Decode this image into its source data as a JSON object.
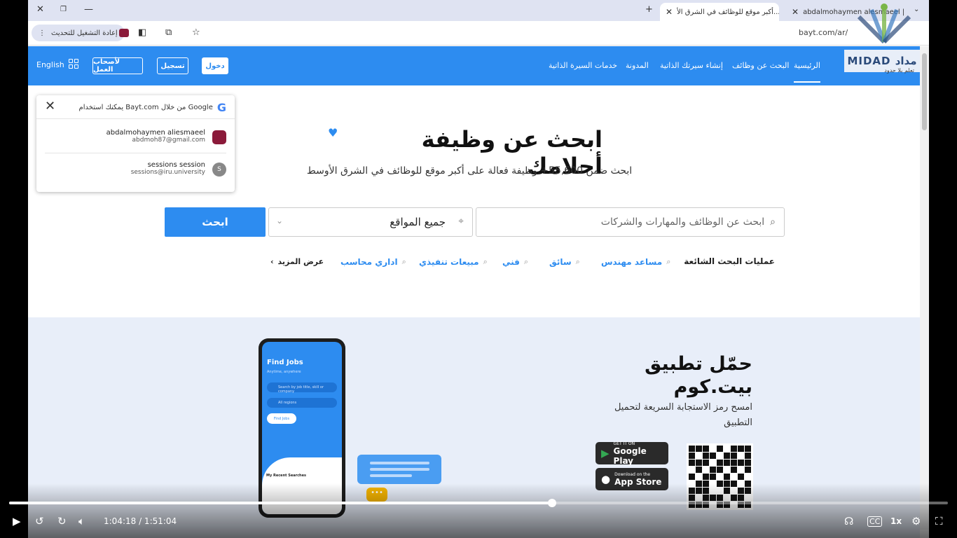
{
  "browser": {
    "tabs": [
      {
        "title": "abdalmohaymen alesmaeel | LinkedIn",
        "favicon": "in"
      },
      {
        "title": "أكبر موقع للوظائف في الشرق الأ...",
        "favicon": "b"
      }
    ],
    "new_tab": "+",
    "relaunch_label": "إعادة التشغيل للتحديث",
    "url": "bayt.com/ar/"
  },
  "watermark": {
    "brand": "MIDAD مداد",
    "tagline": "تعلم بلا حدود"
  },
  "header": {
    "nav": [
      "الرئيسية",
      "البحث عن وظائف",
      "إنشاء سيرتك الذاتية",
      "المدونة",
      "خدمات السيرة الذاتية"
    ],
    "login": "دخول",
    "register": "تسجيل",
    "employers": "لأصحاب العمل",
    "language": "English"
  },
  "google_onetap": {
    "header": "يمكنك استخدام Bayt.com من خلال Google",
    "accounts": [
      {
        "name": "abdalmohaymen aliesmaeel",
        "email": "abdmoh87@gmail.com",
        "avatar": ""
      },
      {
        "name": "sessions session",
        "email": "sessions@iru.university",
        "avatar": "S"
      }
    ]
  },
  "hero": {
    "title": "ابحث عن وظيفة أحلامك",
    "subtitle": "ابحث ضمن 55,600+ وظيفة فعالة على أكبر موقع للوظائف في الشرق الأوسط",
    "keyword_placeholder": "ابحث عن الوظائف والمهارات والشركات",
    "location_value": "جميع المواقع",
    "search_button": "ابحث"
  },
  "popular": {
    "label": "عمليات البحث الشائعة",
    "items": [
      "مساعد مهندس",
      "سائق",
      "فني",
      "مبيعات تنفيذي",
      "اداري محاسب"
    ],
    "more": "عرض المزيد"
  },
  "app_promo": {
    "title_line1": "حمّل تطبيق",
    "title_line2": "بيت.كوم",
    "subtitle": "امسح رمز الاستجابة السريعة لتحميل التطبيق",
    "google_play_small": "GET IT ON",
    "google_play": "Google Play",
    "app_store_small": "Download on the",
    "app_store": "App Store",
    "phone": {
      "title": "Find Jobs",
      "tagline": "Anytime, anywhere",
      "search_placeholder": "Search by job title, skill or company",
      "location_placeholder": "All regions",
      "button": "Find Jobs",
      "recent": "My Recent Searches"
    }
  },
  "player": {
    "time": "1:04:18 / 1:51:04",
    "progress": 0.578,
    "speed": "1x"
  },
  "colors": {
    "accent": "#2d8cf0",
    "promo_bg": "#e8eef9",
    "tabstrip": "#dfe3f2"
  }
}
